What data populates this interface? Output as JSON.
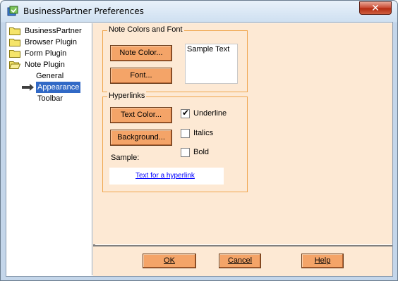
{
  "window": {
    "title": "BusinessPartner Preferences",
    "close_glyph": "✕"
  },
  "tree": {
    "items": [
      {
        "label": "BusinessPartner",
        "icon": "folder-icon"
      },
      {
        "label": "Browser Plugin",
        "icon": "folder-icon"
      },
      {
        "label": "Form Plugin",
        "icon": "folder-icon"
      },
      {
        "label": "Note Plugin",
        "icon": "folder-open-icon"
      },
      {
        "label": "General"
      },
      {
        "label": "Appearance",
        "selected": true
      },
      {
        "label": "Toolbar"
      }
    ]
  },
  "note_colors": {
    "title": "Note Colors and Font",
    "note_color_button": "Note Color...",
    "font_button": "Font...",
    "sample_text": "Sample Text"
  },
  "hyperlinks": {
    "title": "Hyperlinks",
    "text_color_button": "Text Color...",
    "background_button": "Background...",
    "sample_label": "Sample:",
    "sample_link": "Text for a hyperlink",
    "underline": {
      "label": "Underline",
      "checked": true
    },
    "italics": {
      "label": "Italics",
      "checked": false
    },
    "bold": {
      "label": "Bold",
      "checked": false
    }
  },
  "footer": {
    "ok": "OK",
    "cancel": "Cancel",
    "help": "Help"
  },
  "colors": {
    "panel_bg": "#fde9d4",
    "button_bg": "#f4a468",
    "group_border": "#f0a64e",
    "selection": "#3169c6",
    "link": "#0000ff"
  }
}
